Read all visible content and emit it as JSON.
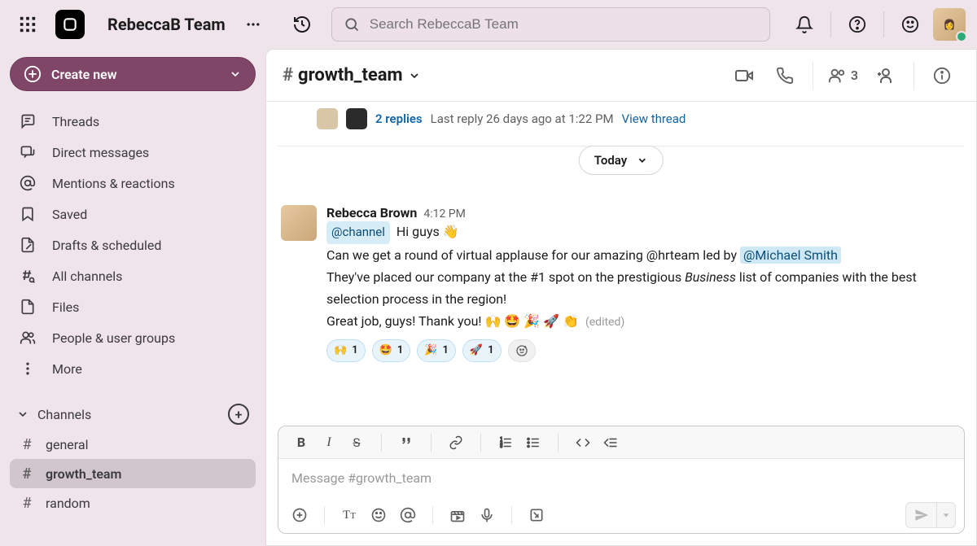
{
  "header": {
    "team_name": "RebeccaB Team",
    "search_placeholder": "Search RebeccaB Team"
  },
  "sidebar": {
    "create_label": "Create new",
    "nav": [
      {
        "label": "Threads",
        "icon": "threads"
      },
      {
        "label": "Direct messages",
        "icon": "dm"
      },
      {
        "label": "Mentions & reactions",
        "icon": "mentions"
      },
      {
        "label": "Saved",
        "icon": "saved"
      },
      {
        "label": "Drafts & scheduled",
        "icon": "drafts"
      },
      {
        "label": "All channels",
        "icon": "allchannels"
      },
      {
        "label": "Files",
        "icon": "files"
      },
      {
        "label": "People & user groups",
        "icon": "people"
      },
      {
        "label": "More",
        "icon": "more"
      }
    ],
    "channels_header": "Channels",
    "channels": [
      {
        "name": "general",
        "active": false
      },
      {
        "name": "growth_team",
        "active": true
      },
      {
        "name": "random",
        "active": false
      }
    ]
  },
  "channel": {
    "name": "growth_team",
    "member_count": "3"
  },
  "thread_summary": {
    "replies_label": "2 replies",
    "last_reply": "Last reply 26 days ago at 1:22 PM",
    "view_label": "View thread"
  },
  "date_separator": "Today",
  "message": {
    "author": "Rebecca Brown",
    "time": "4:12 PM",
    "channel_mention": "@channel",
    "line1_after": "Hi guys 👋",
    "line2_before": "Can we get a round of virtual applause for our amazing @hrteam led by ",
    "user_mention": "@Michael Smith",
    "line3_before": "They've placed our company at the #1 spot on the prestigious ",
    "line3_italic": "Business",
    "line3_after": " list of companies with the best selection process in the region!",
    "line4": "Great job, guys! Thank you! 🙌 🤩 🎉 🚀 👏",
    "edited": "(edited)",
    "reactions": [
      {
        "emoji": "🙌",
        "count": "1"
      },
      {
        "emoji": "🤩",
        "count": "1"
      },
      {
        "emoji": "🎉",
        "count": "1"
      },
      {
        "emoji": "🚀",
        "count": "1"
      }
    ]
  },
  "composer": {
    "placeholder": "Message #growth_team"
  }
}
